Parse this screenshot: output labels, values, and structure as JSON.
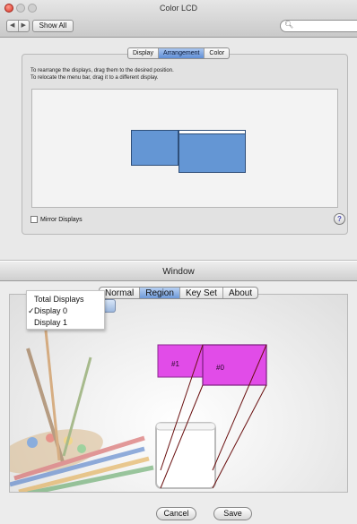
{
  "prefs": {
    "title": "Color LCD",
    "nav_back": "◀",
    "nav_forward": "▶",
    "show_all_label": "Show All",
    "search_placeholder": "",
    "tabs": [
      {
        "label": "Display",
        "selected": false
      },
      {
        "label": "Arrangement",
        "selected": true
      },
      {
        "label": "Color",
        "selected": false
      }
    ],
    "instructions": [
      "To rearrange the displays, drag them to the desired position.",
      "To relocate the menu bar, drag it to a different display."
    ],
    "mirror_label": "Mirror Displays",
    "mirror_checked": false,
    "help_label": "?",
    "display_color": "#6496d4"
  },
  "dialog": {
    "title": "Window",
    "tabs": [
      {
        "label": "Normal",
        "selected": false
      },
      {
        "label": "Region",
        "selected": true
      },
      {
        "label": "Key Set",
        "selected": false
      },
      {
        "label": "About",
        "selected": false
      }
    ],
    "menu": {
      "items": [
        {
          "label": "Total Displays",
          "checked": false
        },
        {
          "label": "Display 0",
          "checked": true
        },
        {
          "label": "Display 1",
          "checked": false
        }
      ],
      "check_glyph": "✓"
    },
    "regions": [
      {
        "label": "#1",
        "color": "#e14ce8"
      },
      {
        "label": "#0",
        "color": "#e14ce8"
      }
    ],
    "cancel_label": "Cancel",
    "save_label": "Save"
  },
  "icons": {
    "search": "search-icon",
    "help": "help-icon",
    "check": "checkmark-icon"
  }
}
